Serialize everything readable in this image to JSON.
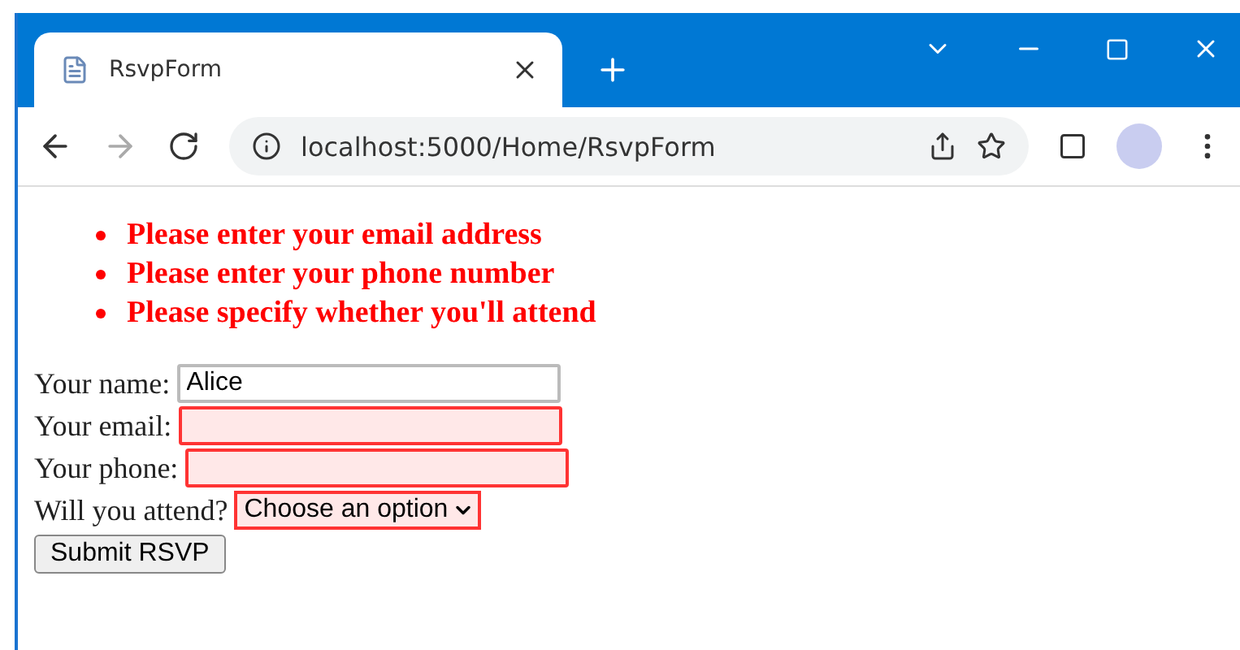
{
  "tab": {
    "title": "RsvpForm",
    "selected": true
  },
  "address_bar": {
    "url": "localhost:5000/Home/RsvpForm"
  },
  "errors": [
    "Please enter your email address",
    "Please enter your phone number",
    "Please specify whether you'll attend"
  ],
  "form": {
    "fields": [
      {
        "kind": "text",
        "label": "Your name:",
        "value": "Alice",
        "invalid": false
      },
      {
        "kind": "text",
        "label": "Your email:",
        "invalid": true
      },
      {
        "kind": "text",
        "label": "Your phone:",
        "invalid": true
      },
      {
        "kind": "select",
        "label": "Will you attend?",
        "value": "Choose an option",
        "invalid": true
      }
    ],
    "submit": "Submit RSVP"
  }
}
